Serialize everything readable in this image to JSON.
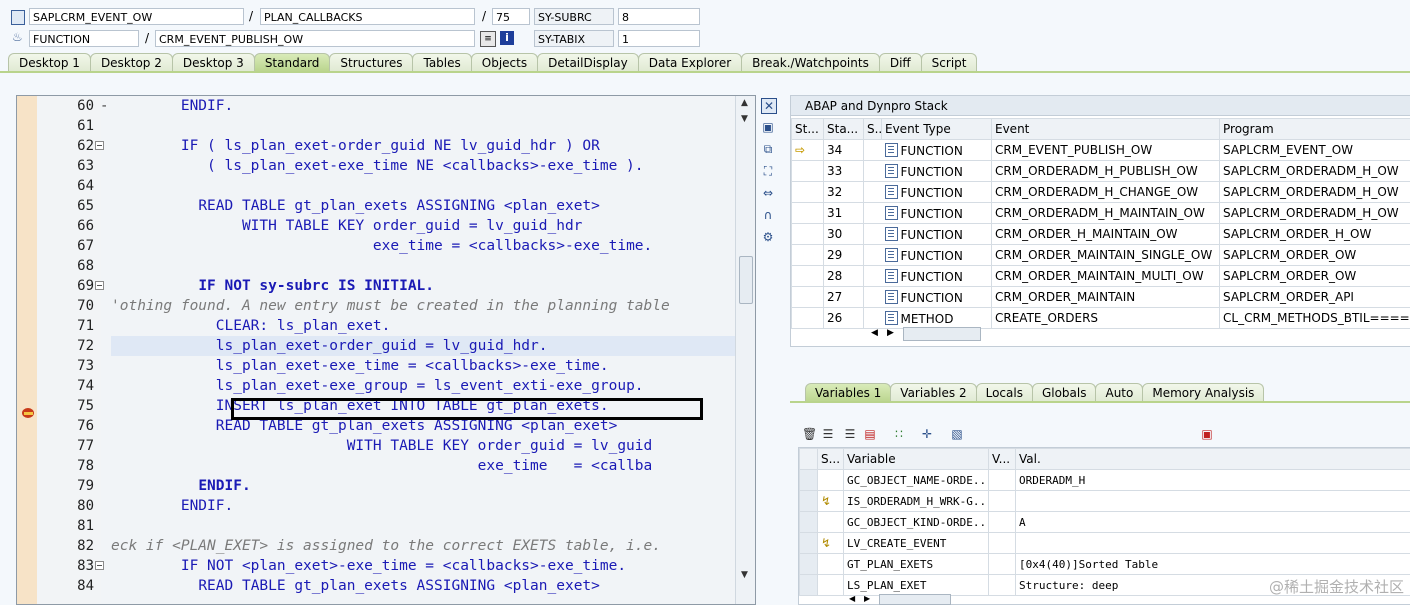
{
  "header": {
    "program": "SAPLCRM_EVENT_OW",
    "include": "PLAN_CALLBACKS",
    "line": "75",
    "sysubrc_label": "SY-SUBRC",
    "sysubrc_value": "8",
    "event_type": "FUNCTION",
    "event": "CRM_EVENT_PUBLISH_OW",
    "sytabix_label": "SY-TABIX",
    "sytabix_value": "1",
    "sep1": "/",
    "sep2": "/",
    "sep3": "/"
  },
  "tabs": [
    "Desktop 1",
    "Desktop 2",
    "Desktop 3",
    "Standard",
    "Structures",
    "Tables",
    "Objects",
    "DetailDisplay",
    "Data Explorer",
    "Break./Watchpoints",
    "Diff",
    "Script"
  ],
  "code": [
    {
      "n": "60",
      "t": "ENDIF.",
      "fold": false,
      "indent": "        "
    },
    {
      "n": "61",
      "t": "",
      "fold": false,
      "indent": ""
    },
    {
      "n": "62",
      "t": "IF ( ls_plan_exet-order_guid NE lv_guid_hdr ) OR",
      "fold": true,
      "indent": "        "
    },
    {
      "n": "63",
      "t": "( ls_plan_exet-exe_time NE <callbacks>-exe_time ).",
      "fold": false,
      "indent": "           "
    },
    {
      "n": "64",
      "t": "",
      "fold": false,
      "indent": ""
    },
    {
      "n": "65",
      "t": "READ TABLE gt_plan_exets ASSIGNING <plan_exet>",
      "fold": false,
      "indent": "          "
    },
    {
      "n": "66",
      "t": "WITH TABLE KEY order_guid = lv_guid_hdr",
      "fold": false,
      "indent": "               "
    },
    {
      "n": "67",
      "t": "exe_time = <callbacks>-exe_time.",
      "fold": false,
      "indent": "                              "
    },
    {
      "n": "68",
      "t": "",
      "fold": false,
      "indent": ""
    },
    {
      "n": "69",
      "t": "IF NOT sy-subrc IS INITIAL.",
      "fold": true,
      "indent": "          "
    },
    {
      "n": "70",
      "t": "'othing found. A new entry must be created in the planning table",
      "fold": false,
      "indent": "",
      "comment": true
    },
    {
      "n": "71",
      "t": "CLEAR: ls_plan_exet.",
      "fold": false,
      "indent": "            "
    },
    {
      "n": "72",
      "t": "ls_plan_exet-order_guid = lv_guid_hdr.",
      "fold": false,
      "indent": "            "
    },
    {
      "n": "73",
      "t": "ls_plan_exet-exe_time = <callbacks>-exe_time.",
      "fold": false,
      "indent": "            "
    },
    {
      "n": "74",
      "t": "ls_plan_exet-exe_group = ls_event_exti-exe_group.",
      "fold": false,
      "indent": "            "
    },
    {
      "n": "75",
      "t": "INSERT ls_plan_exet INTO TABLE gt_plan_exets.",
      "fold": false,
      "indent": "            "
    },
    {
      "n": "76",
      "t": "READ TABLE gt_plan_exets ASSIGNING <plan_exet>",
      "fold": false,
      "indent": "            "
    },
    {
      "n": "77",
      "t": "WITH TABLE KEY order_guid = lv_guid",
      "fold": false,
      "indent": "                           "
    },
    {
      "n": "78",
      "t": "exe_time   = <callba",
      "fold": false,
      "indent": "                                          "
    },
    {
      "n": "79",
      "t": "ENDIF.",
      "fold": false,
      "indent": "          "
    },
    {
      "n": "80",
      "t": "ENDIF.",
      "fold": false,
      "indent": "        "
    },
    {
      "n": "81",
      "t": "",
      "fold": false,
      "indent": ""
    },
    {
      "n": "82",
      "t": "eck if <PLAN_EXET> is assigned to the correct EXETS table, i.e.",
      "fold": false,
      "indent": "",
      "comment": true
    },
    {
      "n": "83",
      "t": "IF NOT <plan_exet>-exe_time = <callbacks>-exe_time.",
      "fold": true,
      "indent": "        "
    },
    {
      "n": "84",
      "t": "READ TABLE gt_plan_exets ASSIGNING <plan_exet>",
      "fold": false,
      "indent": "          "
    }
  ],
  "stack": {
    "title": "ABAP and Dynpro Stack",
    "columns": [
      "St...",
      "Sta...",
      "S...",
      "Event Type",
      "Event",
      "Program"
    ],
    "rows": [
      {
        "level": "34",
        "type": "FUNCTION",
        "event": "CRM_EVENT_PUBLISH_OW",
        "program": "SAPLCRM_EVENT_OW",
        "current": true
      },
      {
        "level": "33",
        "type": "FUNCTION",
        "event": "CRM_ORDERADM_H_PUBLISH_OW",
        "program": "SAPLCRM_ORDERADM_H_OW"
      },
      {
        "level": "32",
        "type": "FUNCTION",
        "event": "CRM_ORDERADM_H_CHANGE_OW",
        "program": "SAPLCRM_ORDERADM_H_OW"
      },
      {
        "level": "31",
        "type": "FUNCTION",
        "event": "CRM_ORDERADM_H_MAINTAIN_OW",
        "program": "SAPLCRM_ORDERADM_H_OW"
      },
      {
        "level": "30",
        "type": "FUNCTION",
        "event": "CRM_ORDER_H_MAINTAIN_OW",
        "program": "SAPLCRM_ORDER_H_OW"
      },
      {
        "level": "29",
        "type": "FUNCTION",
        "event": "CRM_ORDER_MAINTAIN_SINGLE_OW",
        "program": "SAPLCRM_ORDER_OW"
      },
      {
        "level": "28",
        "type": "FUNCTION",
        "event": "CRM_ORDER_MAINTAIN_MULTI_OW",
        "program": "SAPLCRM_ORDER_OW"
      },
      {
        "level": "27",
        "type": "FUNCTION",
        "event": "CRM_ORDER_MAINTAIN",
        "program": "SAPLCRM_ORDER_API"
      },
      {
        "level": "26",
        "type": "METHOD",
        "event": "CREATE_ORDERS",
        "program": "CL_CRM_METHODS_BTIL======"
      }
    ]
  },
  "var_tabs": [
    "Variables 1",
    "Variables 2",
    "Locals",
    "Globals",
    "Auto",
    "Memory Analysis"
  ],
  "vars": {
    "columns": [
      "S...",
      "Variable",
      "V...",
      "Val."
    ],
    "rows": [
      {
        "name": "GC_OBJECT_NAME-ORDE...",
        "value": "ORDERADM_H",
        "icon": false
      },
      {
        "name": "IS_ORDERADM_H_WRK-G...",
        "value": "",
        "icon": true
      },
      {
        "name": "GC_OBJECT_KIND-ORDE...",
        "value": "A",
        "icon": false
      },
      {
        "name": "LV_CREATE_EVENT",
        "value": "",
        "icon": true
      },
      {
        "name": "GT_PLAN_EXETS",
        "value": "[0x4(40)]Sorted Table",
        "icon": false
      },
      {
        "name": "LS_PLAN_EXET",
        "value": "Structure: deep",
        "icon": false
      }
    ]
  },
  "watermark": "@稀土掘金技术社区",
  "colors": {
    "keyword": "#1a1ab5",
    "comment": "#7a7a7a",
    "tab_active": "#b9d48c",
    "gutter": "#f7e3c7"
  }
}
